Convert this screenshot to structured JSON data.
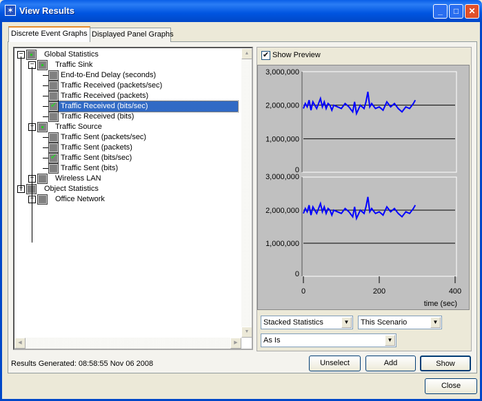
{
  "window": {
    "title": "View Results",
    "controls": [
      "minimize",
      "maximize",
      "close"
    ]
  },
  "tabs": [
    {
      "label": "Discrete Event Graphs",
      "active": true
    },
    {
      "label": "Displayed Panel Graphs",
      "active": false
    }
  ],
  "tree": [
    {
      "label": "Global Statistics",
      "level": 0,
      "expander": "minus",
      "state": "partial"
    },
    {
      "label": "Traffic Sink",
      "level": 1,
      "expander": "minus",
      "state": "partial"
    },
    {
      "label": "End-to-End Delay (seconds)",
      "level": 2,
      "state": "unchecked"
    },
    {
      "label": "Traffic Received (packets/sec)",
      "level": 2,
      "state": "unchecked"
    },
    {
      "label": "Traffic Received (packets)",
      "level": 2,
      "state": "unchecked"
    },
    {
      "label": "Traffic Received (bits/sec)",
      "level": 2,
      "state": "checked",
      "selected": true
    },
    {
      "label": "Traffic Received (bits)",
      "level": 2,
      "state": "unchecked"
    },
    {
      "label": "Traffic Source",
      "level": 1,
      "expander": "minus",
      "state": "partial"
    },
    {
      "label": "Traffic Sent (packets/sec)",
      "level": 2,
      "state": "unchecked"
    },
    {
      "label": "Traffic Sent (packets)",
      "level": 2,
      "state": "unchecked"
    },
    {
      "label": "Traffic Sent (bits/sec)",
      "level": 2,
      "state": "checked"
    },
    {
      "label": "Traffic Sent (bits)",
      "level": 2,
      "state": "unchecked"
    },
    {
      "label": "Wireless LAN",
      "level": 1,
      "expander": "plus",
      "state": "unchecked"
    },
    {
      "label": "Object Statistics",
      "level": 0,
      "expander": "minus",
      "state": "unchecked"
    },
    {
      "label": "Office Network",
      "level": 1,
      "expander": "plus",
      "state": "unchecked"
    }
  ],
  "preview": {
    "label": "Show Preview",
    "checked": true
  },
  "chart_data": {
    "type": "line",
    "layout": "stacked",
    "color": "#0000ff",
    "xlabel": "time (sec)",
    "xlim": [
      0,
      400
    ],
    "xticks": [
      "0",
      "200",
      "400"
    ],
    "ylim": [
      0,
      3000000
    ],
    "yticks": [
      "0",
      "1,000,000",
      "2,000,000",
      "3,000,000"
    ],
    "grid": true,
    "panels": [
      {
        "x": [
          0,
          5,
          10,
          15,
          20,
          25,
          30,
          35,
          40,
          45,
          50,
          55,
          60,
          65,
          70,
          75,
          80,
          90,
          100,
          110,
          120,
          130,
          135,
          140,
          150,
          160,
          165,
          170,
          175,
          180,
          190,
          200,
          210,
          220,
          230,
          240,
          250,
          260,
          270,
          280,
          290,
          295
        ],
        "y": [
          1900000,
          2050000,
          1950000,
          2150000,
          1850000,
          2100000,
          2000000,
          1900000,
          2050000,
          2200000,
          1950000,
          2100000,
          1900000,
          2050000,
          2000000,
          1850000,
          2000000,
          1950000,
          1900000,
          2050000,
          1950000,
          1800000,
          2100000,
          1750000,
          2000000,
          1900000,
          2100000,
          2400000,
          1950000,
          2050000,
          1900000,
          1950000,
          1850000,
          2100000,
          1950000,
          2050000,
          1900000,
          1800000,
          1950000,
          1900000,
          2050000,
          2150000
        ]
      },
      {
        "x": [
          0,
          5,
          10,
          15,
          20,
          25,
          30,
          35,
          40,
          45,
          50,
          55,
          60,
          65,
          70,
          75,
          80,
          90,
          100,
          110,
          120,
          130,
          135,
          140,
          150,
          160,
          165,
          170,
          175,
          180,
          190,
          200,
          210,
          220,
          230,
          240,
          250,
          260,
          270,
          280,
          290,
          295
        ],
        "y": [
          1900000,
          2050000,
          1950000,
          2150000,
          1850000,
          2100000,
          2000000,
          1900000,
          2050000,
          2200000,
          1950000,
          2100000,
          1900000,
          2050000,
          2000000,
          1850000,
          2000000,
          1950000,
          1900000,
          2050000,
          1950000,
          1800000,
          2100000,
          1750000,
          2000000,
          1900000,
          2100000,
          2400000,
          1950000,
          2050000,
          1900000,
          1950000,
          1850000,
          2100000,
          1950000,
          2050000,
          1900000,
          1800000,
          1950000,
          1900000,
          2050000,
          2150000
        ]
      }
    ]
  },
  "dropdowns": {
    "stat_mode": "Stacked Statistics",
    "scenario": "This Scenario",
    "filter": "As Is"
  },
  "status": "Results Generated: 08:58:55 Nov 06 2008",
  "buttons": {
    "unselect": "Unselect",
    "add": "Add",
    "show": "Show",
    "close": "Close"
  }
}
